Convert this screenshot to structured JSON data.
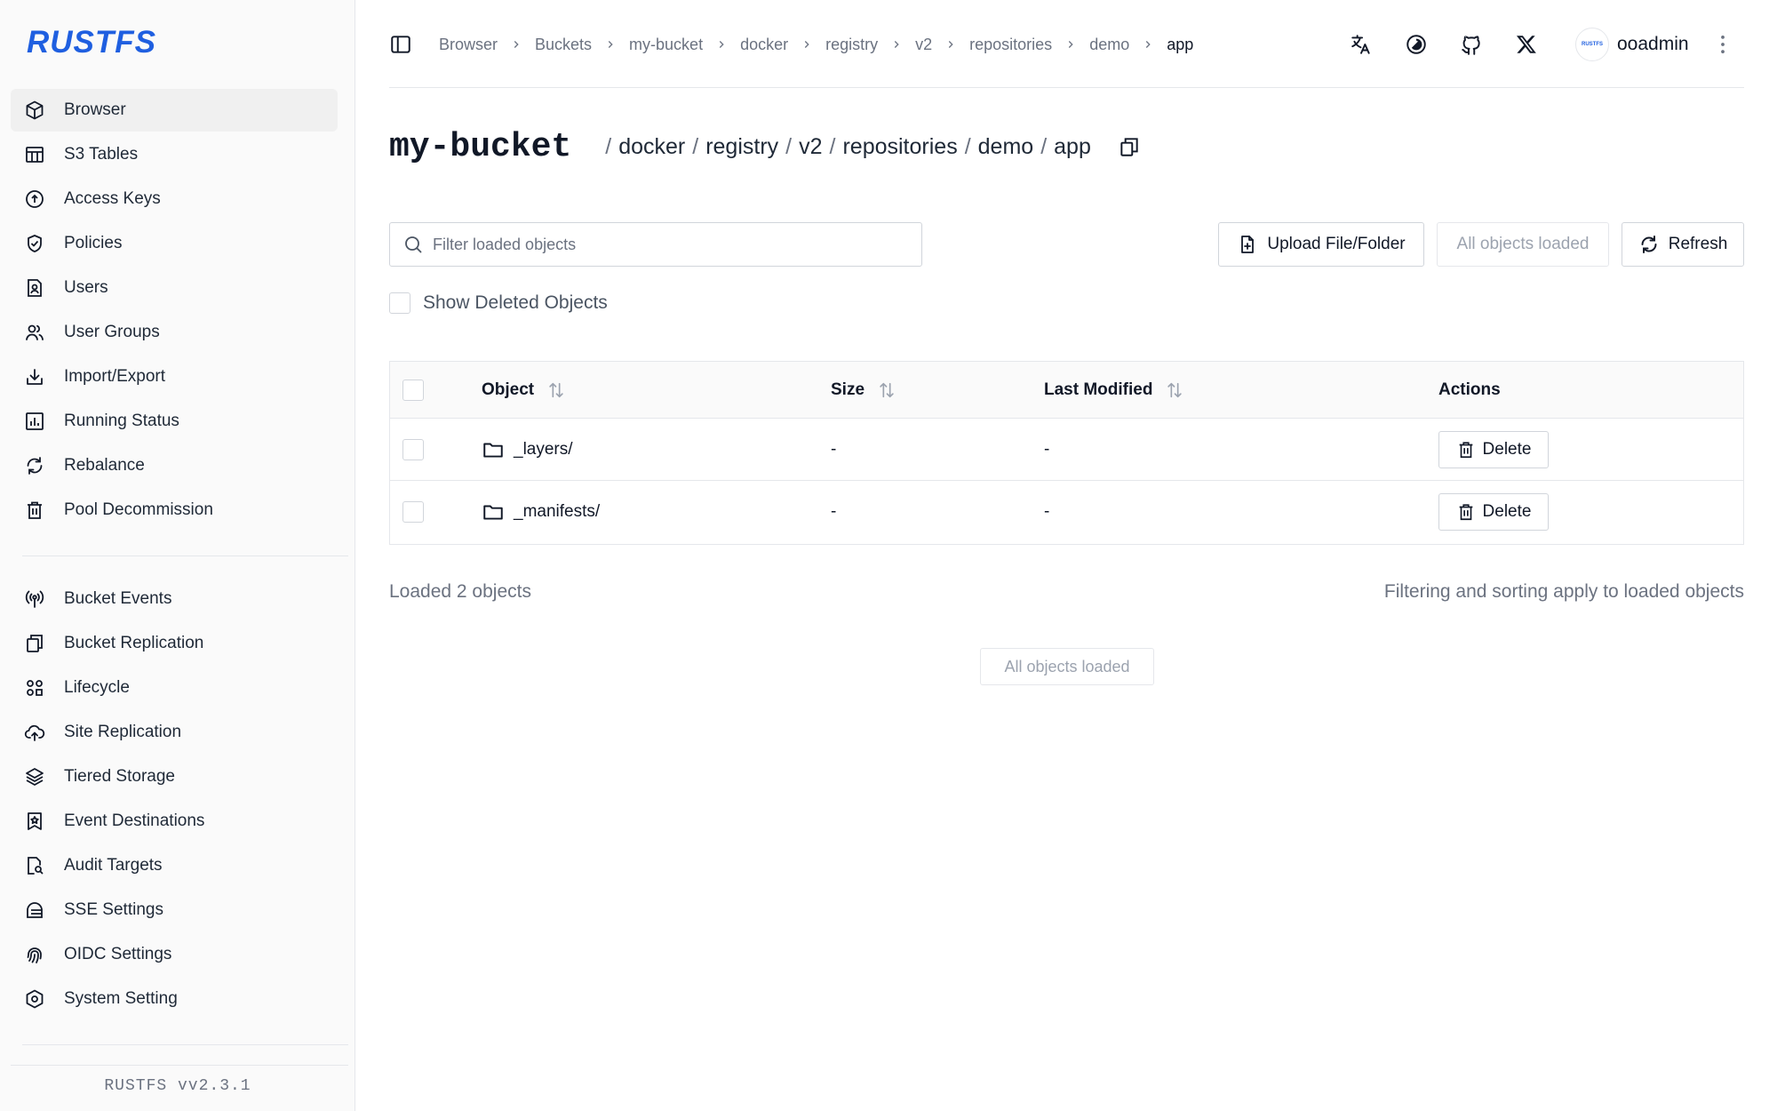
{
  "app": {
    "logo": "RUSTFS",
    "version": "RUSTFS  vv2.3.1"
  },
  "sidebar": {
    "group1": [
      {
        "label": "Browser",
        "icon": "cube-icon",
        "active": true
      },
      {
        "label": "S3 Tables",
        "icon": "table-icon"
      },
      {
        "label": "Access Keys",
        "icon": "key-circle-icon"
      },
      {
        "label": "Policies",
        "icon": "shield-check-icon"
      },
      {
        "label": "Users",
        "icon": "user-badge-icon"
      },
      {
        "label": "User Groups",
        "icon": "users-icon"
      },
      {
        "label": "Import/Export",
        "icon": "download-tray-icon"
      },
      {
        "label": "Running Status",
        "icon": "bar-chart-icon"
      },
      {
        "label": "Rebalance",
        "icon": "refresh-icon"
      },
      {
        "label": "Pool Decommission",
        "icon": "trash-icon"
      }
    ],
    "group2": [
      {
        "label": "Bucket Events",
        "icon": "broadcast-icon"
      },
      {
        "label": "Bucket Replication",
        "icon": "copy-icon"
      },
      {
        "label": "Lifecycle",
        "icon": "lifecycle-icon"
      },
      {
        "label": "Site Replication",
        "icon": "cloud-upload-icon"
      },
      {
        "label": "Tiered Storage",
        "icon": "layers-icon"
      },
      {
        "label": "Event Destinations",
        "icon": "bookmark-star-icon"
      },
      {
        "label": "Audit Targets",
        "icon": "file-search-icon"
      },
      {
        "label": "SSE Settings",
        "icon": "encryption-icon"
      },
      {
        "label": "OIDC Settings",
        "icon": "fingerprint-icon"
      },
      {
        "label": "System Setting",
        "icon": "hexagon-gear-icon"
      }
    ]
  },
  "topbar": {
    "breadcrumbs": [
      "Browser",
      "Buckets",
      "my-bucket",
      "docker",
      "registry",
      "v2",
      "repositories",
      "demo",
      "app"
    ],
    "username": "ooadmin",
    "avatar_text": "RUSTFS"
  },
  "title": {
    "bucket": "my-bucket",
    "path": [
      "docker",
      "registry",
      "v2",
      "repositories",
      "demo",
      "app"
    ]
  },
  "toolbar": {
    "filter_placeholder": "Filter loaded objects",
    "upload_label": "Upload File/Folder",
    "all_loaded_label": "All objects loaded",
    "refresh_label": "Refresh",
    "show_deleted_label": "Show Deleted Objects"
  },
  "table": {
    "headers": {
      "object": "Object",
      "size": "Size",
      "modified": "Last Modified",
      "actions": "Actions"
    },
    "rows": [
      {
        "name": "_layers/",
        "size": "-",
        "modified": "-",
        "action": "Delete"
      },
      {
        "name": "_manifests/",
        "size": "-",
        "modified": "-",
        "action": "Delete"
      }
    ]
  },
  "footer": {
    "loaded_count": "Loaded 2 objects",
    "note": "Filtering and sorting apply to loaded objects",
    "load_more_label": "All objects loaded"
  },
  "colors": {
    "brand": "#1f5fe0",
    "muted": "#6b7280",
    "border": "#e5e7eb"
  }
}
